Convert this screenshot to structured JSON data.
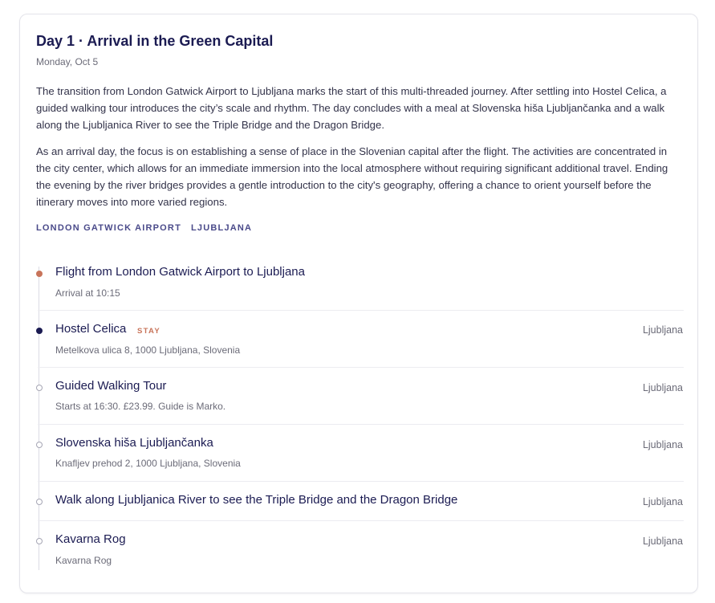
{
  "day": {
    "title": "Day 1 · Arrival in the Green Capital",
    "date": "Monday, Oct 5",
    "paragraphs": [
      "The transition from London Gatwick Airport to Ljubljana marks the start of this multi-threaded journey. After settling into Hostel Celica, a guided walking tour introduces the city’s scale and rhythm. The day concludes with a meal at Slovenska hiša Ljubljančanka and a walk along the Ljubljanica River to see the Triple Bridge and the Dragon Bridge.",
      "As an arrival day, the focus is on establishing a sense of place in the Slovenian capital after the flight. The activities are concentrated in the city center, which allows for an immediate immersion into the local atmosphere without requiring significant additional travel. Ending the evening by the river bridges provides a gentle introduction to the city's geography, offering a chance to orient yourself before the itinerary moves into more varied regions."
    ],
    "tags": [
      "LONDON GATWICK AIRPORT",
      "LJUBLJANA"
    ]
  },
  "timeline": [
    {
      "title": "Flight from London Gatwick Airport to Ljubljana",
      "subtitle": "Arrival at 10:15",
      "location": "",
      "badge": "",
      "marker": "filled-accent",
      "icon": "flight-dot-icon"
    },
    {
      "title": "Hostel Celica",
      "subtitle": "Metelkova ulica 8, 1000 Ljubljana, Slovenia",
      "location": "Ljubljana",
      "badge": "STAY",
      "marker": "filled-dark",
      "icon": "stay-dot-icon"
    },
    {
      "title": "Guided Walking Tour",
      "subtitle": "Starts at 16:30. £23.99. Guide is Marko.",
      "location": "Ljubljana",
      "badge": "",
      "marker": "hollow",
      "icon": "activity-dot-icon"
    },
    {
      "title": "Slovenska hiša Ljubljančanka",
      "subtitle": "Knafljev prehod 2, 1000 Ljubljana, Slovenia",
      "location": "Ljubljana",
      "badge": "",
      "marker": "hollow",
      "icon": "activity-dot-icon"
    },
    {
      "title": "Walk along Ljubljanica River to see the Triple Bridge and the Dragon Bridge",
      "subtitle": "",
      "location": "Ljubljana",
      "badge": "",
      "marker": "hollow",
      "icon": "activity-dot-icon"
    },
    {
      "title": "Kavarna Rog",
      "subtitle": "Kavarna Rog",
      "location": "Ljubljana",
      "badge": "",
      "marker": "hollow",
      "icon": "activity-dot-icon"
    }
  ],
  "colors": {
    "title": "#1b1b52",
    "accent": "#c8745a",
    "muted": "#6b6b78",
    "tag": "#4a4a8a"
  }
}
